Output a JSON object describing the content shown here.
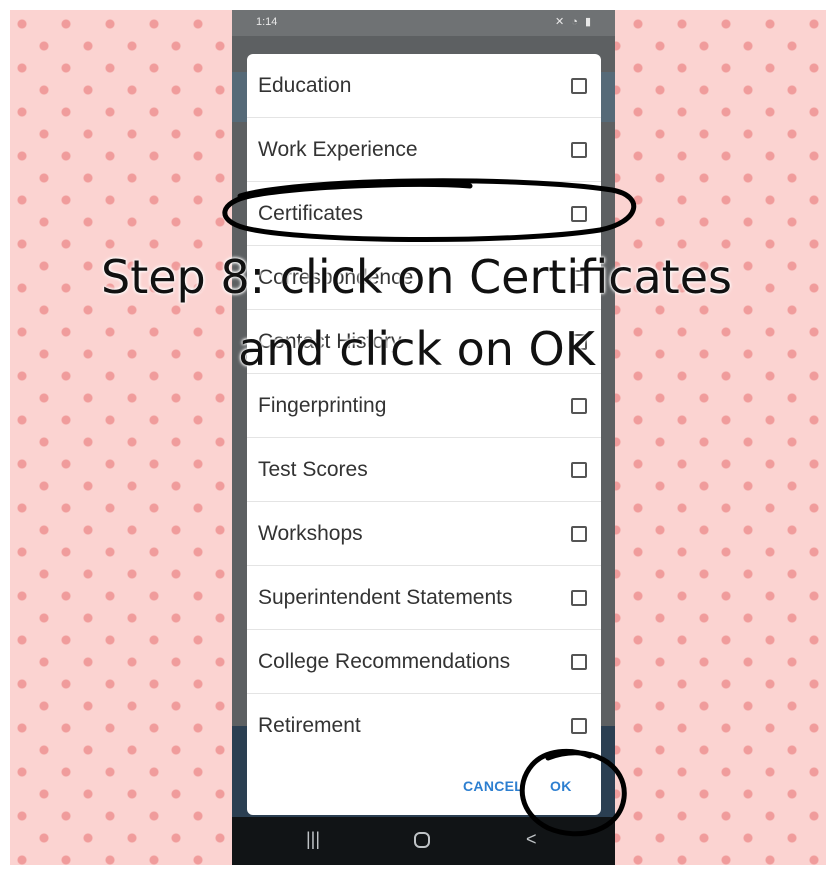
{
  "status_bar": {
    "time": "1:14",
    "icons": "✕ ◔ ▮"
  },
  "dialog": {
    "items": [
      {
        "label": "Education"
      },
      {
        "label": "Work Experience"
      },
      {
        "label": "Certificates"
      },
      {
        "label": "Correspondence"
      },
      {
        "label": "Contact History"
      },
      {
        "label": "Fingerprinting"
      },
      {
        "label": "Test Scores"
      },
      {
        "label": "Workshops"
      },
      {
        "label": "Superintendent Statements"
      },
      {
        "label": "College Recommendations"
      },
      {
        "label": "Retirement"
      }
    ],
    "cancel_label": "CANCEL",
    "ok_label": "OK"
  },
  "nav_bar": {
    "recents": "|||",
    "back": "<"
  },
  "overlay": {
    "line1": "Step 8: click on Certificates",
    "line2": "and click on OK"
  },
  "colors": {
    "background_pink": "#fbd3d1",
    "accent_blue": "#2d7fd0",
    "annotation_ink": "#000000"
  }
}
